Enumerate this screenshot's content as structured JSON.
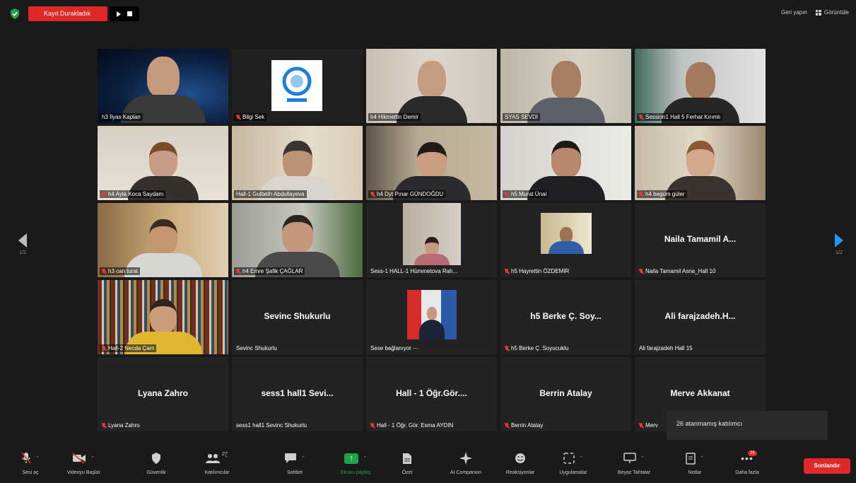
{
  "topbar": {
    "recording_label": "Kayıt Durakladık",
    "exit_fullscreen": "Geri yapın",
    "view": "Görüntüle"
  },
  "tiles": [
    {
      "name": "h3 İlyas Kaplan",
      "video": true,
      "muted": false
    },
    {
      "name": "Bilgi Sek",
      "video": true,
      "muted": true
    },
    {
      "name": "h4 Hikmettin Demir",
      "video": true,
      "muted": false
    },
    {
      "name": "SYAS SEVDİ",
      "video": true,
      "muted": false,
      "active": true
    },
    {
      "name": "Session1 Hall 5 Ferhat Kırımlı",
      "video": true,
      "muted": true
    },
    {
      "name": "h4 Ayla Koca Saydam",
      "video": true,
      "muted": true
    },
    {
      "name": "Hall-1 Gulbeth Abdullayeva",
      "video": true,
      "muted": false
    },
    {
      "name": "h4 Dyt Pınar GÜNDOĞDU",
      "video": true,
      "muted": true
    },
    {
      "name": "h5 Murat Ünal",
      "video": true,
      "muted": true
    },
    {
      "name": "h4 begüm güler",
      "video": true,
      "muted": true
    },
    {
      "name": "h3 can tural",
      "video": true,
      "muted": true
    },
    {
      "name": "h4 Emre Şafik ÇAĞLAR",
      "video": true,
      "muted": true
    },
    {
      "name": "Sess-1 HALL-1 Hümmetova Rah...",
      "video": true,
      "muted": false
    },
    {
      "name": "h5 Hayrettin ÖZDEMİR",
      "video": true,
      "muted": true
    },
    {
      "name": "Naila Tamamil Asna_Hall 10",
      "center": "Naila Tamamil A...",
      "video": false,
      "muted": true
    },
    {
      "name": "Hall-2 Necda Çam",
      "video": true,
      "muted": true
    },
    {
      "name": "Sevinc Shukurlu",
      "center": "Sevinc Shukurlu",
      "video": false,
      "muted": false
    },
    {
      "name": "Sese bağlanıyor ⋯",
      "video": true,
      "muted": false
    },
    {
      "name": "h5 Berke Ç. Soyucuklu",
      "center": "h5 Berke Ç. Soy...",
      "video": false,
      "muted": true
    },
    {
      "name": "Ali farajzadeh Hall 15",
      "center": "Ali farajzadeh.H...",
      "video": false,
      "muted": false
    },
    {
      "name": "Lyana Zahro",
      "center": "Lyana Zahro",
      "video": false,
      "muted": true
    },
    {
      "name": "sess1 hall1 Sevinc Shukurlu",
      "center": "sess1 hall1 Sevi...",
      "video": false,
      "muted": false
    },
    {
      "name": "Hall - 1 Öğr. Gör. Esma AYDIN",
      "center": "Hall - 1 Öğr.Gör....",
      "video": false,
      "muted": true
    },
    {
      "name": "Berrin Atalay",
      "center": "Berrin Atalay",
      "video": false,
      "muted": true
    },
    {
      "name": "Merv",
      "center": "Merve Akkanat",
      "video": false,
      "muted": true
    }
  ],
  "pagination": {
    "left": "1/2",
    "right": "1/2"
  },
  "tooltip": "26 atanmamış katılımcı",
  "toolbar": {
    "unmute": "Sesi aç",
    "start_video": "Videoyu Başlat",
    "security": "Güvenlik",
    "participants": "Katılımcılar",
    "participants_count": "27",
    "chat": "Sohbet",
    "share": "Ekranı paylaş",
    "summary": "Özet",
    "ai": "AI Companion",
    "reactions": "Reaksiyonlar",
    "apps": "Uygulamalar",
    "whiteboard": "Beyaz Tahtalar",
    "notes": "Notlar",
    "more": "Daha fazla",
    "more_badge": "26",
    "end": "Sonlandır"
  }
}
